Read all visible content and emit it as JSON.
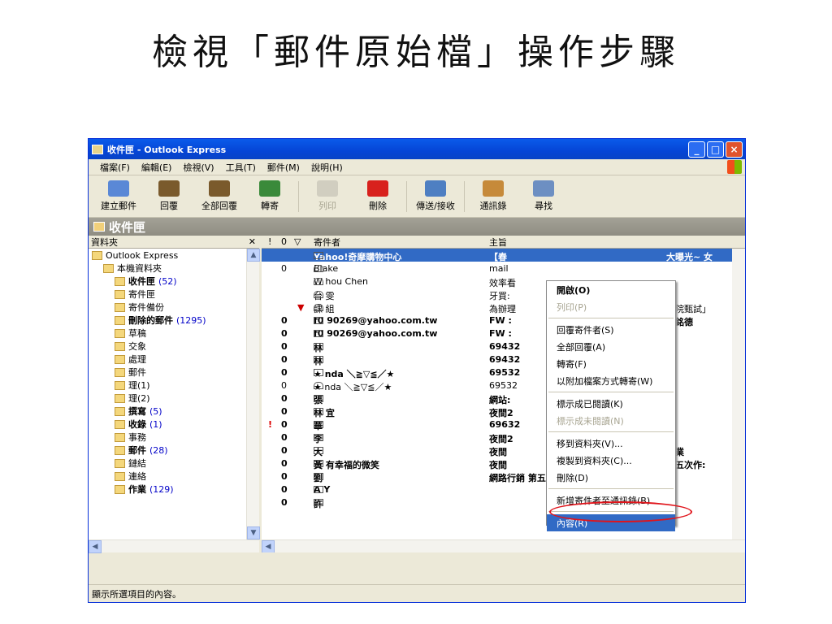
{
  "slide_title": "檢視「郵件原始檔」操作步驟",
  "window": {
    "title": "收件匣 - Outlook Express"
  },
  "menu": [
    "檔案(F)",
    "編輯(E)",
    "檢視(V)",
    "工具(T)",
    "郵件(M)",
    "說明(H)"
  ],
  "toolbar": [
    {
      "label": "建立郵件",
      "enabled": true,
      "icon": "new-mail-icon",
      "color": "#5a88d6"
    },
    {
      "label": "回覆",
      "enabled": true,
      "icon": "reply-icon",
      "color": "#7a5a2c"
    },
    {
      "label": "全部回覆",
      "enabled": true,
      "icon": "reply-all-icon",
      "color": "#7a5a2c"
    },
    {
      "label": "轉寄",
      "enabled": true,
      "icon": "forward-icon",
      "color": "#3a8a3a"
    },
    {
      "label": "列印",
      "enabled": false,
      "icon": "print-icon",
      "color": "#b5b3a8"
    },
    {
      "label": "刪除",
      "enabled": true,
      "icon": "delete-icon",
      "color": "#d8211d"
    },
    {
      "label": "傳送/接收",
      "enabled": true,
      "icon": "send-receive-icon",
      "color": "#4e7fc2"
    },
    {
      "label": "通訊錄",
      "enabled": true,
      "icon": "address-book-icon",
      "color": "#c68a3a"
    },
    {
      "label": "尋找",
      "enabled": true,
      "icon": "find-icon",
      "color": "#6d8fc2"
    }
  ],
  "banner": "收件匣",
  "folders_header": "資料夾",
  "folders": [
    {
      "label": "Outlook Express",
      "count": "",
      "bold": false,
      "indent": 0
    },
    {
      "label": "本機資料夾",
      "count": "",
      "bold": false,
      "indent": 1
    },
    {
      "label": "收件匣",
      "count": "(52)",
      "bold": true,
      "indent": 2
    },
    {
      "label": "寄件匣",
      "count": "",
      "bold": false,
      "indent": 2
    },
    {
      "label": "寄件備份",
      "count": "",
      "bold": false,
      "indent": 2
    },
    {
      "label": "刪除的郵件",
      "count": "(1295)",
      "bold": true,
      "indent": 2
    },
    {
      "label": "草稿",
      "count": "",
      "bold": false,
      "indent": 2
    },
    {
      "label": "交象",
      "count": "",
      "bold": false,
      "indent": 2
    },
    {
      "label": "處理",
      "count": "",
      "bold": false,
      "indent": 2
    },
    {
      "label": "郵件",
      "count": "",
      "bold": false,
      "indent": 2
    },
    {
      "label": "理(1)",
      "count": "",
      "bold": false,
      "indent": 2
    },
    {
      "label": "理(2)",
      "count": "",
      "bold": false,
      "indent": 2
    },
    {
      "label": "撰寫",
      "count": "(5)",
      "bold": true,
      "indent": 2
    },
    {
      "label": "收錄",
      "count": "(1)",
      "bold": true,
      "indent": 2
    },
    {
      "label": "事務",
      "count": "",
      "bold": false,
      "indent": 2
    },
    {
      "label": "郵件",
      "count": "(28)",
      "bold": true,
      "indent": 2
    },
    {
      "label": "鏈結",
      "count": "",
      "bold": false,
      "indent": 2
    },
    {
      "label": "連絡",
      "count": "",
      "bold": false,
      "indent": 2
    },
    {
      "label": "作業",
      "count": "(129)",
      "bold": true,
      "indent": 2
    }
  ],
  "message_columns": {
    "flag": "!",
    "attach": "0",
    "mark": "▽",
    "from": "寄件者",
    "subject": "主旨"
  },
  "messages": [
    {
      "att": "",
      "from": "Yahoo!奇摩購物中心",
      "subject": "【春",
      "bold": true,
      "sel": true,
      "flag": "",
      "mark": "",
      "env": "closed",
      "rsub": "大曝光~ 女"
    },
    {
      "att": "0",
      "from": "Blake",
      "subject": "mail",
      "bold": false,
      "sel": false,
      "flag": "",
      "mark": "",
      "env": "open",
      "rsub": ""
    },
    {
      "att": "",
      "from": "W    hou Chen",
      "subject": "效率看",
      "bold": false,
      "sel": false,
      "flag": "",
      "mark": "",
      "env": "open",
      "rsub": ""
    },
    {
      "att": "",
      "from": "台    雯",
      "subject": "牙買:",
      "bold": false,
      "sel": false,
      "flag": "",
      "mark": "",
      "env": "open",
      "rsub": ""
    },
    {
      "att": "",
      "from": "課    組",
      "subject": "為辦理",
      "bold": false,
      "sel": false,
      "flag": "",
      "mark": "▼",
      "env": "open",
      "rsub": "校院甄試」"
    },
    {
      "att": "0",
      "from": "f0    90269@yahoo.com.tw",
      "subject": "FW :",
      "bold": true,
      "sel": false,
      "flag": "",
      "mark": "",
      "env": "closed",
      "rsub": "洪銘德"
    },
    {
      "att": "0",
      "from": "f0    90269@yahoo.com.tw",
      "subject": "FW :",
      "bold": true,
      "sel": false,
      "flag": "",
      "mark": "",
      "env": "closed",
      "rsub": ""
    },
    {
      "att": "0",
      "from": "林    ",
      "subject": "69432",
      "bold": true,
      "sel": false,
      "flag": "",
      "mark": "",
      "env": "closed",
      "rsub": ""
    },
    {
      "att": "0",
      "from": "林    ",
      "subject": "69432",
      "bold": true,
      "sel": false,
      "flag": "",
      "mark": "",
      "env": "closed",
      "rsub": "1"
    },
    {
      "att": "0",
      "from": "★    nda ＼≧▽≦／★",
      "subject": "69532",
      "bold": true,
      "sel": false,
      "flag": "",
      "mark": "",
      "env": "closed",
      "rsub": ""
    },
    {
      "att": "0",
      "from": "★    nda ＼≧▽≦／★",
      "subject": "69532",
      "bold": false,
      "sel": false,
      "flag": "",
      "mark": "",
      "env": "open",
      "rsub": ""
    },
    {
      "att": "0",
      "from": "張    ",
      "subject": "網站:",
      "bold": true,
      "sel": false,
      "flag": "",
      "mark": "",
      "env": "closed",
      "rsub": ""
    },
    {
      "att": "0",
      "from": "林    宜",
      "subject": "夜間2",
      "bold": true,
      "sel": false,
      "flag": "",
      "mark": "",
      "env": "closed",
      "rsub": ""
    },
    {
      "att": "0",
      "from": "華    ",
      "subject": "69632",
      "bold": true,
      "sel": false,
      "flag": "!",
      "mark": "",
      "env": "closed",
      "rsub": ""
    },
    {
      "att": "0",
      "from": "李    ",
      "subject": "夜間2",
      "bold": true,
      "sel": false,
      "flag": "",
      "mark": "",
      "env": "closed",
      "rsub": ""
    },
    {
      "att": "0",
      "from": "大    ",
      "subject": "夜間",
      "bold": true,
      "sel": false,
      "flag": "",
      "mark": "",
      "env": "closed",
      "rsub": "作業"
    },
    {
      "att": "0",
      "from": "黃    有幸福的微笑",
      "subject": "夜間",
      "bold": true,
      "sel": false,
      "flag": "",
      "mark": "",
      "env": "closed",
      "rsub": "第五次作:"
    },
    {
      "att": "0",
      "from": "劉    ",
      "subject": "網路行銷 第五次作業",
      "bold": true,
      "sel": false,
      "flag": "",
      "mark": "",
      "env": "closed",
      "rsub": ""
    },
    {
      "att": "0",
      "from": "A Y",
      "subject": "",
      "bold": true,
      "sel": false,
      "flag": "",
      "mark": "",
      "env": "closed",
      "rsub": ""
    },
    {
      "att": "0",
      "from": "許    ",
      "subject": "",
      "bold": true,
      "sel": false,
      "flag": "",
      "mark": "",
      "env": "closed",
      "rsub": ""
    }
  ],
  "context_menu": [
    {
      "label": "開啟(O)",
      "state": "bold"
    },
    {
      "label": "列印(P)",
      "state": "disabled"
    },
    {
      "sep": true
    },
    {
      "label": "回覆寄件者(S)",
      "state": ""
    },
    {
      "label": "全部回覆(A)",
      "state": ""
    },
    {
      "label": "轉寄(F)",
      "state": ""
    },
    {
      "label": "以附加檔案方式轉寄(W)",
      "state": ""
    },
    {
      "sep": true
    },
    {
      "label": "標示成已閱讀(K)",
      "state": ""
    },
    {
      "label": "標示成未閱讀(N)",
      "state": "disabled"
    },
    {
      "sep": true
    },
    {
      "label": "移到資料夾(V)...",
      "state": ""
    },
    {
      "label": "複製到資料夾(C)...",
      "state": ""
    },
    {
      "label": "刪除(D)",
      "state": ""
    },
    {
      "sep": true
    },
    {
      "label": "新增寄件者至通訊錄(B)",
      "state": ""
    },
    {
      "sep": true
    },
    {
      "label": "內容(R)",
      "state": "highlight"
    }
  ],
  "status_text": "顯示所選項目的內容。",
  "colors": {
    "highlight": "#316ac5",
    "annotation_oval": "#e0141b",
    "title_bar": "#0a5bea"
  }
}
